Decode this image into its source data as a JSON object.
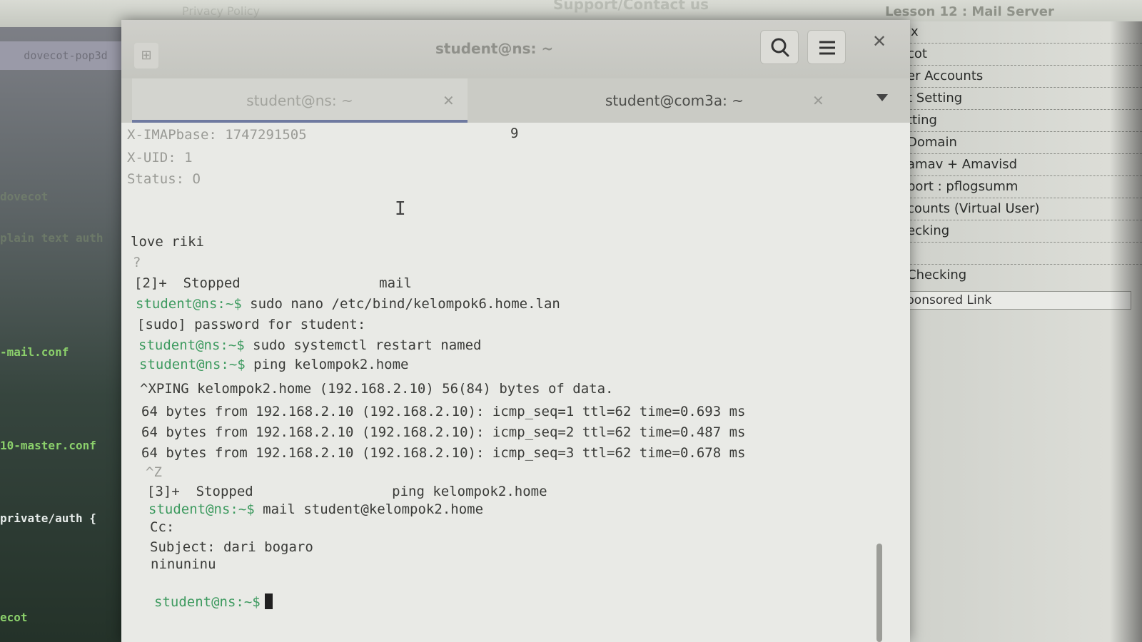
{
  "background": {
    "page_top": {
      "text_left": "Privacy Policy",
      "text_center": "Support/Contact us",
      "text_right": "Lesson 12 : Mail Server"
    },
    "left_editor": {
      "tab_label": "dovecot-pop3d",
      "lines": [
        "dovecot",
        "plain text auth",
        "-mail.conf",
        "10-master.conf",
        "private/auth {",
        "ecot"
      ]
    },
    "right_sidebar": {
      "items": [
        "ix",
        "cot",
        "er Accounts",
        "t Setting",
        "tting",
        "Domain",
        "amav + Amavisd",
        "port : pflogsumm",
        "counts (Virtual User)",
        "ecking",
        "",
        "Checking"
      ],
      "sponsored": "ponsored Link"
    }
  },
  "terminal": {
    "window_title": "student@ns: ~",
    "tabs": [
      {
        "label": "student@ns: ~",
        "active": true
      },
      {
        "label": "student@com3a: ~",
        "active": false
      }
    ],
    "lines": [
      {
        "text": "X-IMAPbase: 1747291505",
        "kind": "meta"
      },
      {
        "text": "9",
        "kind": "plain"
      },
      {
        "text": "X-UID: 1",
        "kind": "meta"
      },
      {
        "text": "Status: O",
        "kind": "meta"
      },
      {
        "text": "love riki",
        "kind": "plain"
      },
      {
        "text": "?",
        "kind": "meta"
      },
      {
        "text": "[2]+  Stopped                 mail",
        "kind": "plain"
      },
      {
        "prompt": "student@ns:~$",
        "text": " sudo nano /etc/bind/kelompok6.home.lan",
        "kind": "cmd"
      },
      {
        "text": "[sudo] password for student:",
        "kind": "plain"
      },
      {
        "prompt": "student@ns:~$",
        "text": " sudo systemctl restart named",
        "kind": "cmd"
      },
      {
        "prompt": "student@ns:~$",
        "text": " ping kelompok2.home",
        "kind": "cmd"
      },
      {
        "text": "^XPING kelompok2.home (192.168.2.10) 56(84) bytes of data.",
        "kind": "plain"
      },
      {
        "text": "64 bytes from 192.168.2.10 (192.168.2.10): icmp_seq=1 ttl=62 time=0.693 ms",
        "kind": "plain"
      },
      {
        "text": "64 bytes from 192.168.2.10 (192.168.2.10): icmp_seq=2 ttl=62 time=0.487 ms",
        "kind": "plain"
      },
      {
        "text": "64 bytes from 192.168.2.10 (192.168.2.10): icmp_seq=3 ttl=62 time=0.678 ms",
        "kind": "plain"
      },
      {
        "text": "^Z",
        "kind": "meta"
      },
      {
        "text": "[3]+  Stopped                 ping kelompok2.home",
        "kind": "plain"
      },
      {
        "prompt": "student@ns:~$",
        "text": " mail student@kelompok2.home",
        "kind": "cmd"
      },
      {
        "text": "Cc:",
        "kind": "plain"
      },
      {
        "text": "Subject: dari bogaro",
        "kind": "plain"
      },
      {
        "text": "ninuninu",
        "kind": "plain"
      },
      {
        "prompt": "student@ns:~$",
        "text": "",
        "kind": "cmd"
      }
    ]
  },
  "colors": {
    "prompt": "#3d9a5f",
    "active_tab_indicator": "#6f7aa0"
  }
}
